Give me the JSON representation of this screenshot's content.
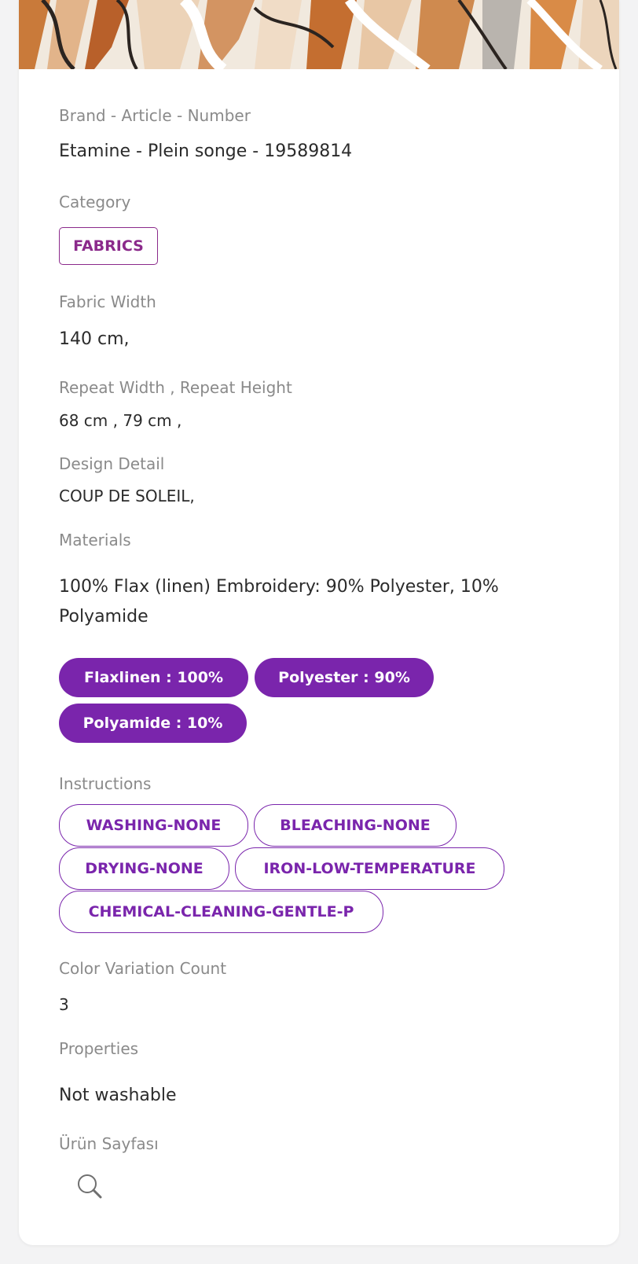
{
  "details": {
    "brand_label": "Brand - Article - Number",
    "brand_value": "Etamine - Plein songe - 19589814",
    "category_label": "Category",
    "category_tag": "FABRICS",
    "fabric_width_label": "Fabric Width",
    "fabric_width_value": "140 cm,",
    "repeat_label": "Repeat Width , Repeat Height",
    "repeat_value": "68 cm , 79 cm ,",
    "design_label": "Design Detail",
    "design_value": "COUP DE SOLEIL,",
    "materials_label": "Materials",
    "materials_line1": "100% Flax (linen) Embroidery: 90% Polyester, 10%",
    "materials_line2": "Polyamide",
    "material_tags": [
      "Flaxlinen : 100%",
      "Polyester : 90%",
      "Polyamide : 10%"
    ],
    "instructions_label": "Instructions",
    "instruction_tags": [
      "WASHING-NONE",
      "BLEACHING-NONE",
      "DRYING-NONE",
      "IRON-LOW-TEMPERATURE",
      "CHEMICAL-CLEANING-GENTLE-P"
    ],
    "color_count_label": "Color Variation Count",
    "color_count_value": "3",
    "properties_label": "Properties",
    "properties_value": "Not washable",
    "product_page_label": "Ürün Sayfası",
    "product_page_icon": "search-icon"
  },
  "colors": {
    "accent_purple": "#7a25ac",
    "category_border": "#8b2a8b",
    "label_gray": "#8a8a8a",
    "value_text": "#2b2b2b"
  }
}
